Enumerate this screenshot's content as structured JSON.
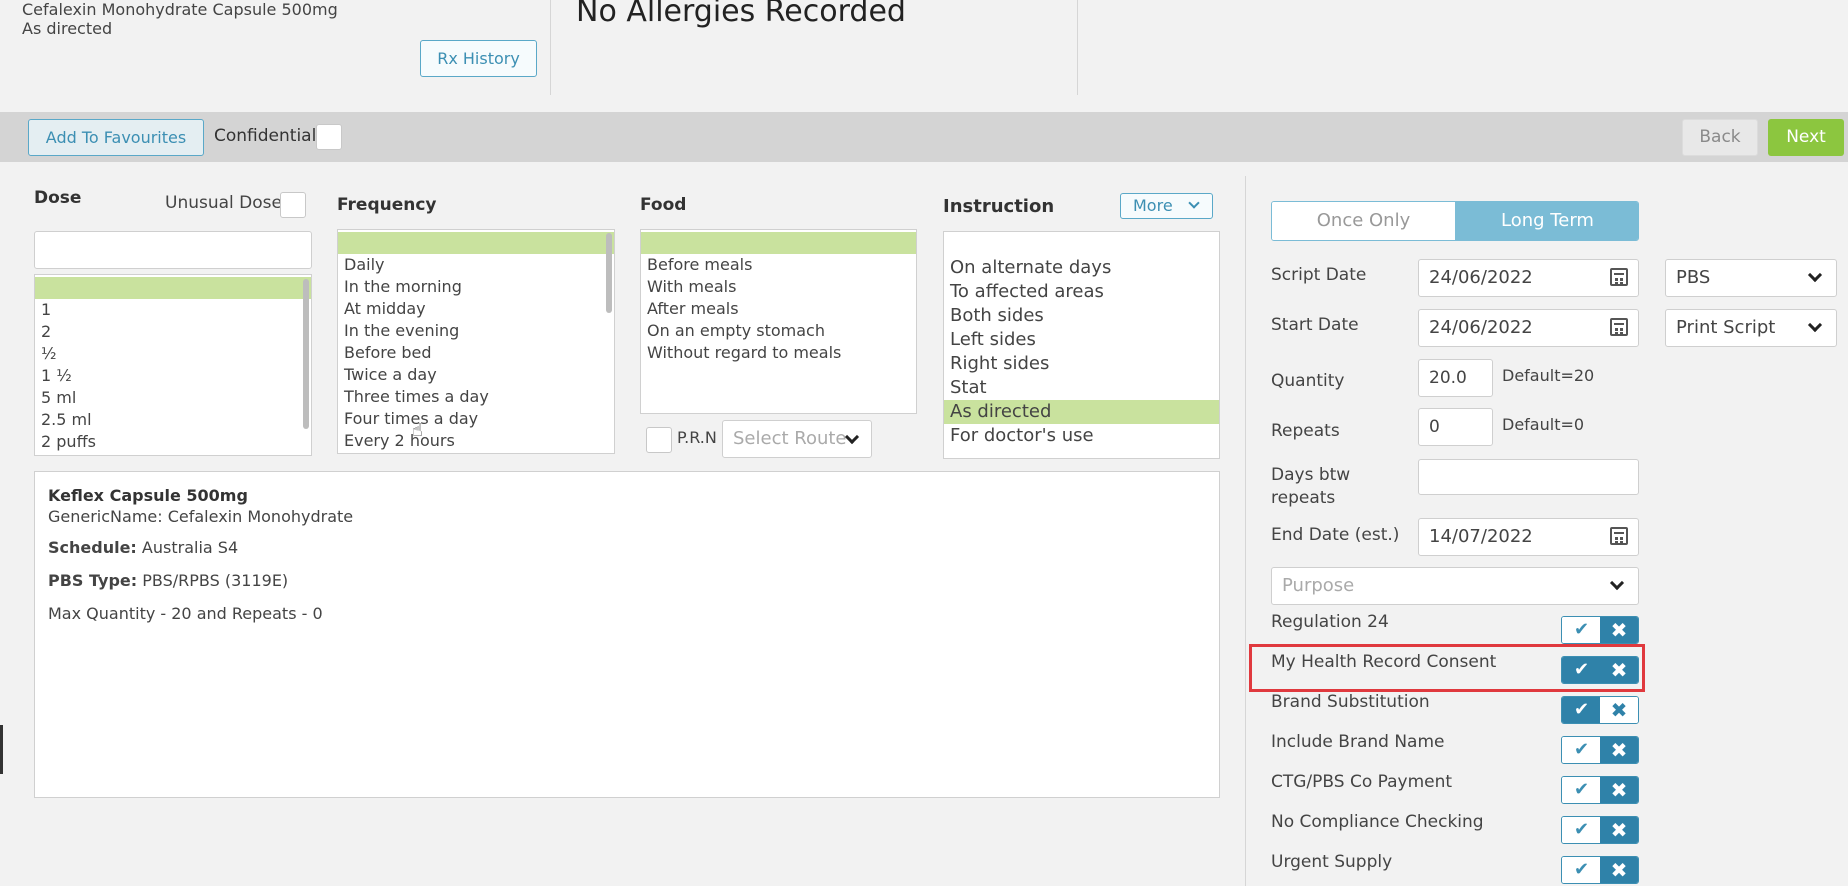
{
  "header": {
    "rx_line1": "Cefalexin Monohydrate Capsule 500mg",
    "rx_line2": "As directed",
    "rx_history": "Rx History",
    "allergies": "No Allergies Recorded"
  },
  "toolbar": {
    "add_favourites": "Add To Favourites",
    "confidential": "Confidential",
    "back": "Back",
    "next": "Next"
  },
  "dose": {
    "label": "Dose",
    "unusual_label": "Unusual Dose",
    "input_value": "",
    "items": [
      "",
      "1",
      "2",
      "½",
      "1 ½",
      "5 ml",
      "2.5 ml",
      "2 puffs"
    ]
  },
  "frequency": {
    "label": "Frequency",
    "items": [
      "",
      "Daily",
      "In the morning",
      "At midday",
      "In the evening",
      "Before bed",
      "Twice a day",
      "Three times a day",
      "Four times a day",
      "Every 2 hours"
    ]
  },
  "food": {
    "label": "Food",
    "items": [
      "",
      "Before meals",
      "With meals",
      "After meals",
      "On an empty stomach",
      "Without regard to meals"
    ],
    "prn": "P.R.N",
    "route_placeholder": "Select Route"
  },
  "instruction": {
    "label": "Instruction",
    "more": "More",
    "items": [
      "On alternate days",
      "To affected areas",
      "Both sides",
      "Left sides",
      "Right sides",
      "Stat",
      "As directed",
      "For doctor's use"
    ],
    "selected": "As directed"
  },
  "drug_info": {
    "name": "Keflex Capsule 500mg",
    "generic": "GenericName: Cefalexin Monohydrate",
    "schedule_label": "Schedule:",
    "schedule_value": "Australia S4",
    "pbs_label": "PBS Type:",
    "pbs_value": "PBS/RPBS (3119E)",
    "max": "Max Quantity - 20 and Repeats - 0"
  },
  "right": {
    "once_only": "Once Only",
    "long_term": "Long Term",
    "script_date_label": "Script Date",
    "script_date": "24/06/2022",
    "pbs_select": "PBS",
    "start_date_label": "Start Date",
    "start_date": "24/06/2022",
    "print_select": "Print Script",
    "quantity_label": "Quantity",
    "quantity": "20.0",
    "quantity_default": "Default=20",
    "repeats_label": "Repeats",
    "repeats": "0",
    "repeats_default": "Default=0",
    "days_label_1": "Days btw",
    "days_label_2": "repeats",
    "days_value": "",
    "end_date_label": "End Date (est.)",
    "end_date": "14/07/2022",
    "purpose_placeholder": "Purpose",
    "toggles": [
      {
        "label": "Regulation 24",
        "state": "no"
      },
      {
        "label": "My Health Record Consent",
        "state": "no"
      },
      {
        "label": "Brand Substitution",
        "state": "yes"
      },
      {
        "label": "Include Brand Name",
        "state": "no"
      },
      {
        "label": "CTG/PBS Co Payment",
        "state": "no"
      },
      {
        "label": "No Compliance Checking",
        "state": "no"
      },
      {
        "label": "Urgent Supply",
        "state": "no"
      }
    ]
  },
  "colors": {
    "accent": "#2f82a9",
    "selected": "#c9e29e",
    "next": "#8cc63f",
    "highlight": "#e0393e"
  }
}
